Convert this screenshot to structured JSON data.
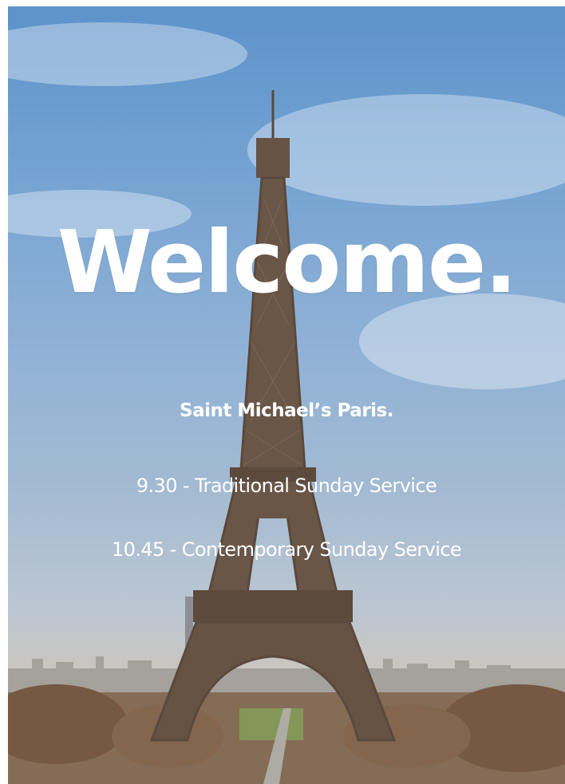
{
  "hero": {
    "title": "Welcome.",
    "subtitle": "Saint Michael’s Paris.",
    "services": [
      {
        "text": "9.30 - Traditional Sunday Service"
      },
      {
        "text": "10.45 - Contemporary Sunday Service"
      }
    ],
    "background_image": "eiffel-tower-paris",
    "colors": {
      "text": "#ffffff",
      "sky_top": "#4f8ac6",
      "sky_bottom": "#aab7c6",
      "tower": "#5a4535"
    }
  }
}
